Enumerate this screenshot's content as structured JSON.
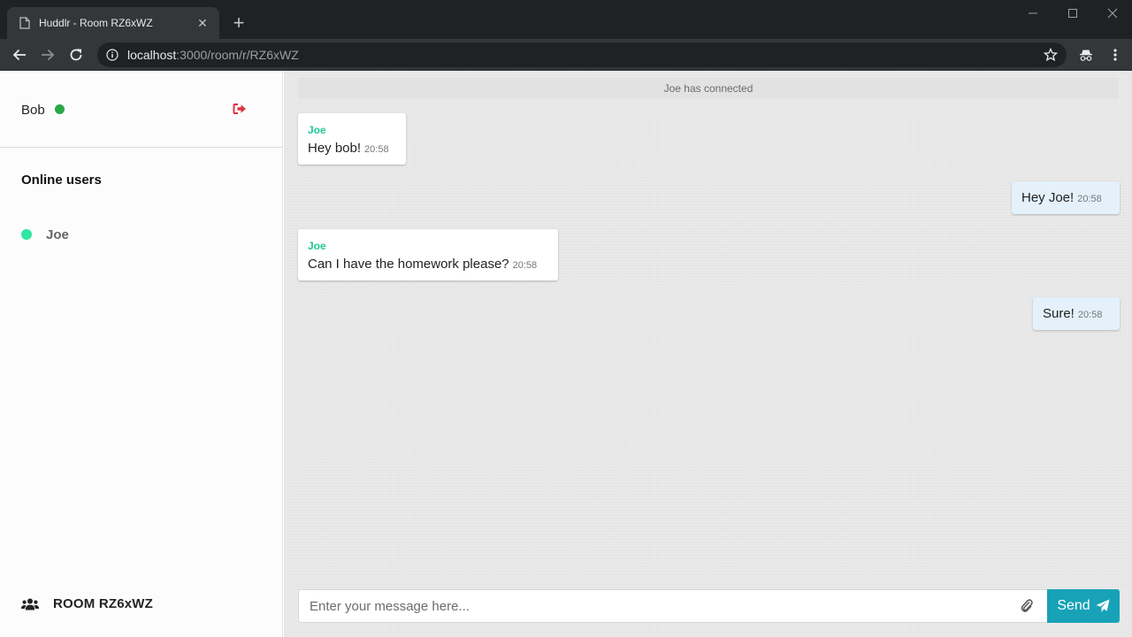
{
  "browser": {
    "tab_title": "Huddlr - Room RZ6xWZ",
    "url_host": "localhost",
    "url_rest": ":3000/room/r/RZ6xWZ"
  },
  "sidebar": {
    "user_name": "Bob",
    "online_title": "Online users",
    "online_users": [
      {
        "name": "Joe"
      }
    ],
    "room_label": "ROOM RZ6xWZ"
  },
  "chat": {
    "system_message": "Joe has connected",
    "messages": [
      {
        "author": "Joe",
        "text": "Hey bob!",
        "time": "20:58",
        "direction": "in"
      },
      {
        "text": "Hey Joe!",
        "time": "20:58",
        "direction": "out"
      },
      {
        "author": "Joe",
        "text": "Can I have the homework please?",
        "time": "20:58",
        "direction": "in"
      },
      {
        "text": "Sure!",
        "time": "20:58",
        "direction": "out"
      }
    ]
  },
  "composer": {
    "placeholder": "Enter your message here...",
    "send_label": "Send"
  },
  "colors": {
    "online": "#28a745",
    "online_user_dot": "#2ee6a0",
    "author": "#20c997",
    "logout": "#dc3545",
    "send": "#17a2b8",
    "out_bubble": "#e4f1fb"
  }
}
